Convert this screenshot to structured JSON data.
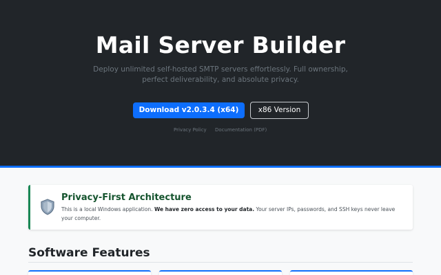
{
  "hero": {
    "title": "Mail Server Builder",
    "subtitle": "Deploy unlimited self-hosted SMTP servers effortlessly. Full ownership, perfect deliverability, and absolute privacy.",
    "download_button": "Download v2.0.3.4 (x64)",
    "x86_button": "x86 Version",
    "links": [
      "Privacy Policy",
      "Documentation (PDF)"
    ]
  },
  "privacy": {
    "icon": "shield-icon",
    "title": "Privacy-First Architecture",
    "text_before": "This is a local Windows application. ",
    "text_bold": "We have zero access to your data.",
    "text_after": " Your server IPs, passwords, and SSH keys never leave your computer."
  },
  "features": {
    "title": "Software Features"
  },
  "colors": {
    "hero_bg": "#212529",
    "accent": "#0d6efd",
    "success": "#198754"
  }
}
